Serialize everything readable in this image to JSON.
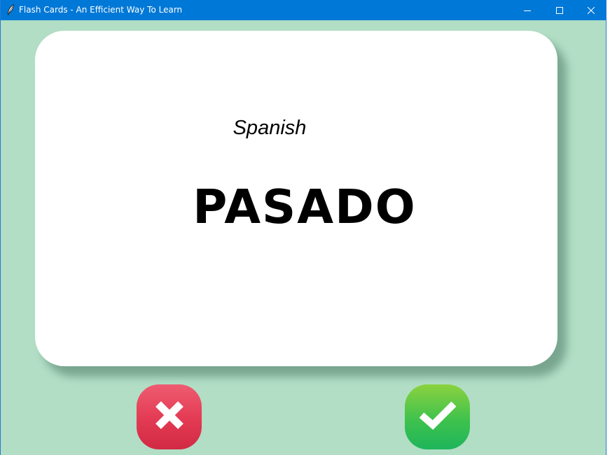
{
  "window": {
    "title": "Flash Cards - An Efficient Way To Learn",
    "controls": {
      "minimize_icon": "minimize-icon",
      "maximize_icon": "maximize-icon",
      "close_icon": "close-icon"
    },
    "titlebar_color": "#0078d7"
  },
  "background_color": "#b1dec5",
  "card": {
    "language": "Spanish",
    "word": "PASADO",
    "color": "#ffffff"
  },
  "actions": {
    "wrong": {
      "icon": "cross-icon",
      "color": "#e33a53"
    },
    "right": {
      "icon": "checkmark-icon",
      "color": "#3fc24d"
    }
  }
}
